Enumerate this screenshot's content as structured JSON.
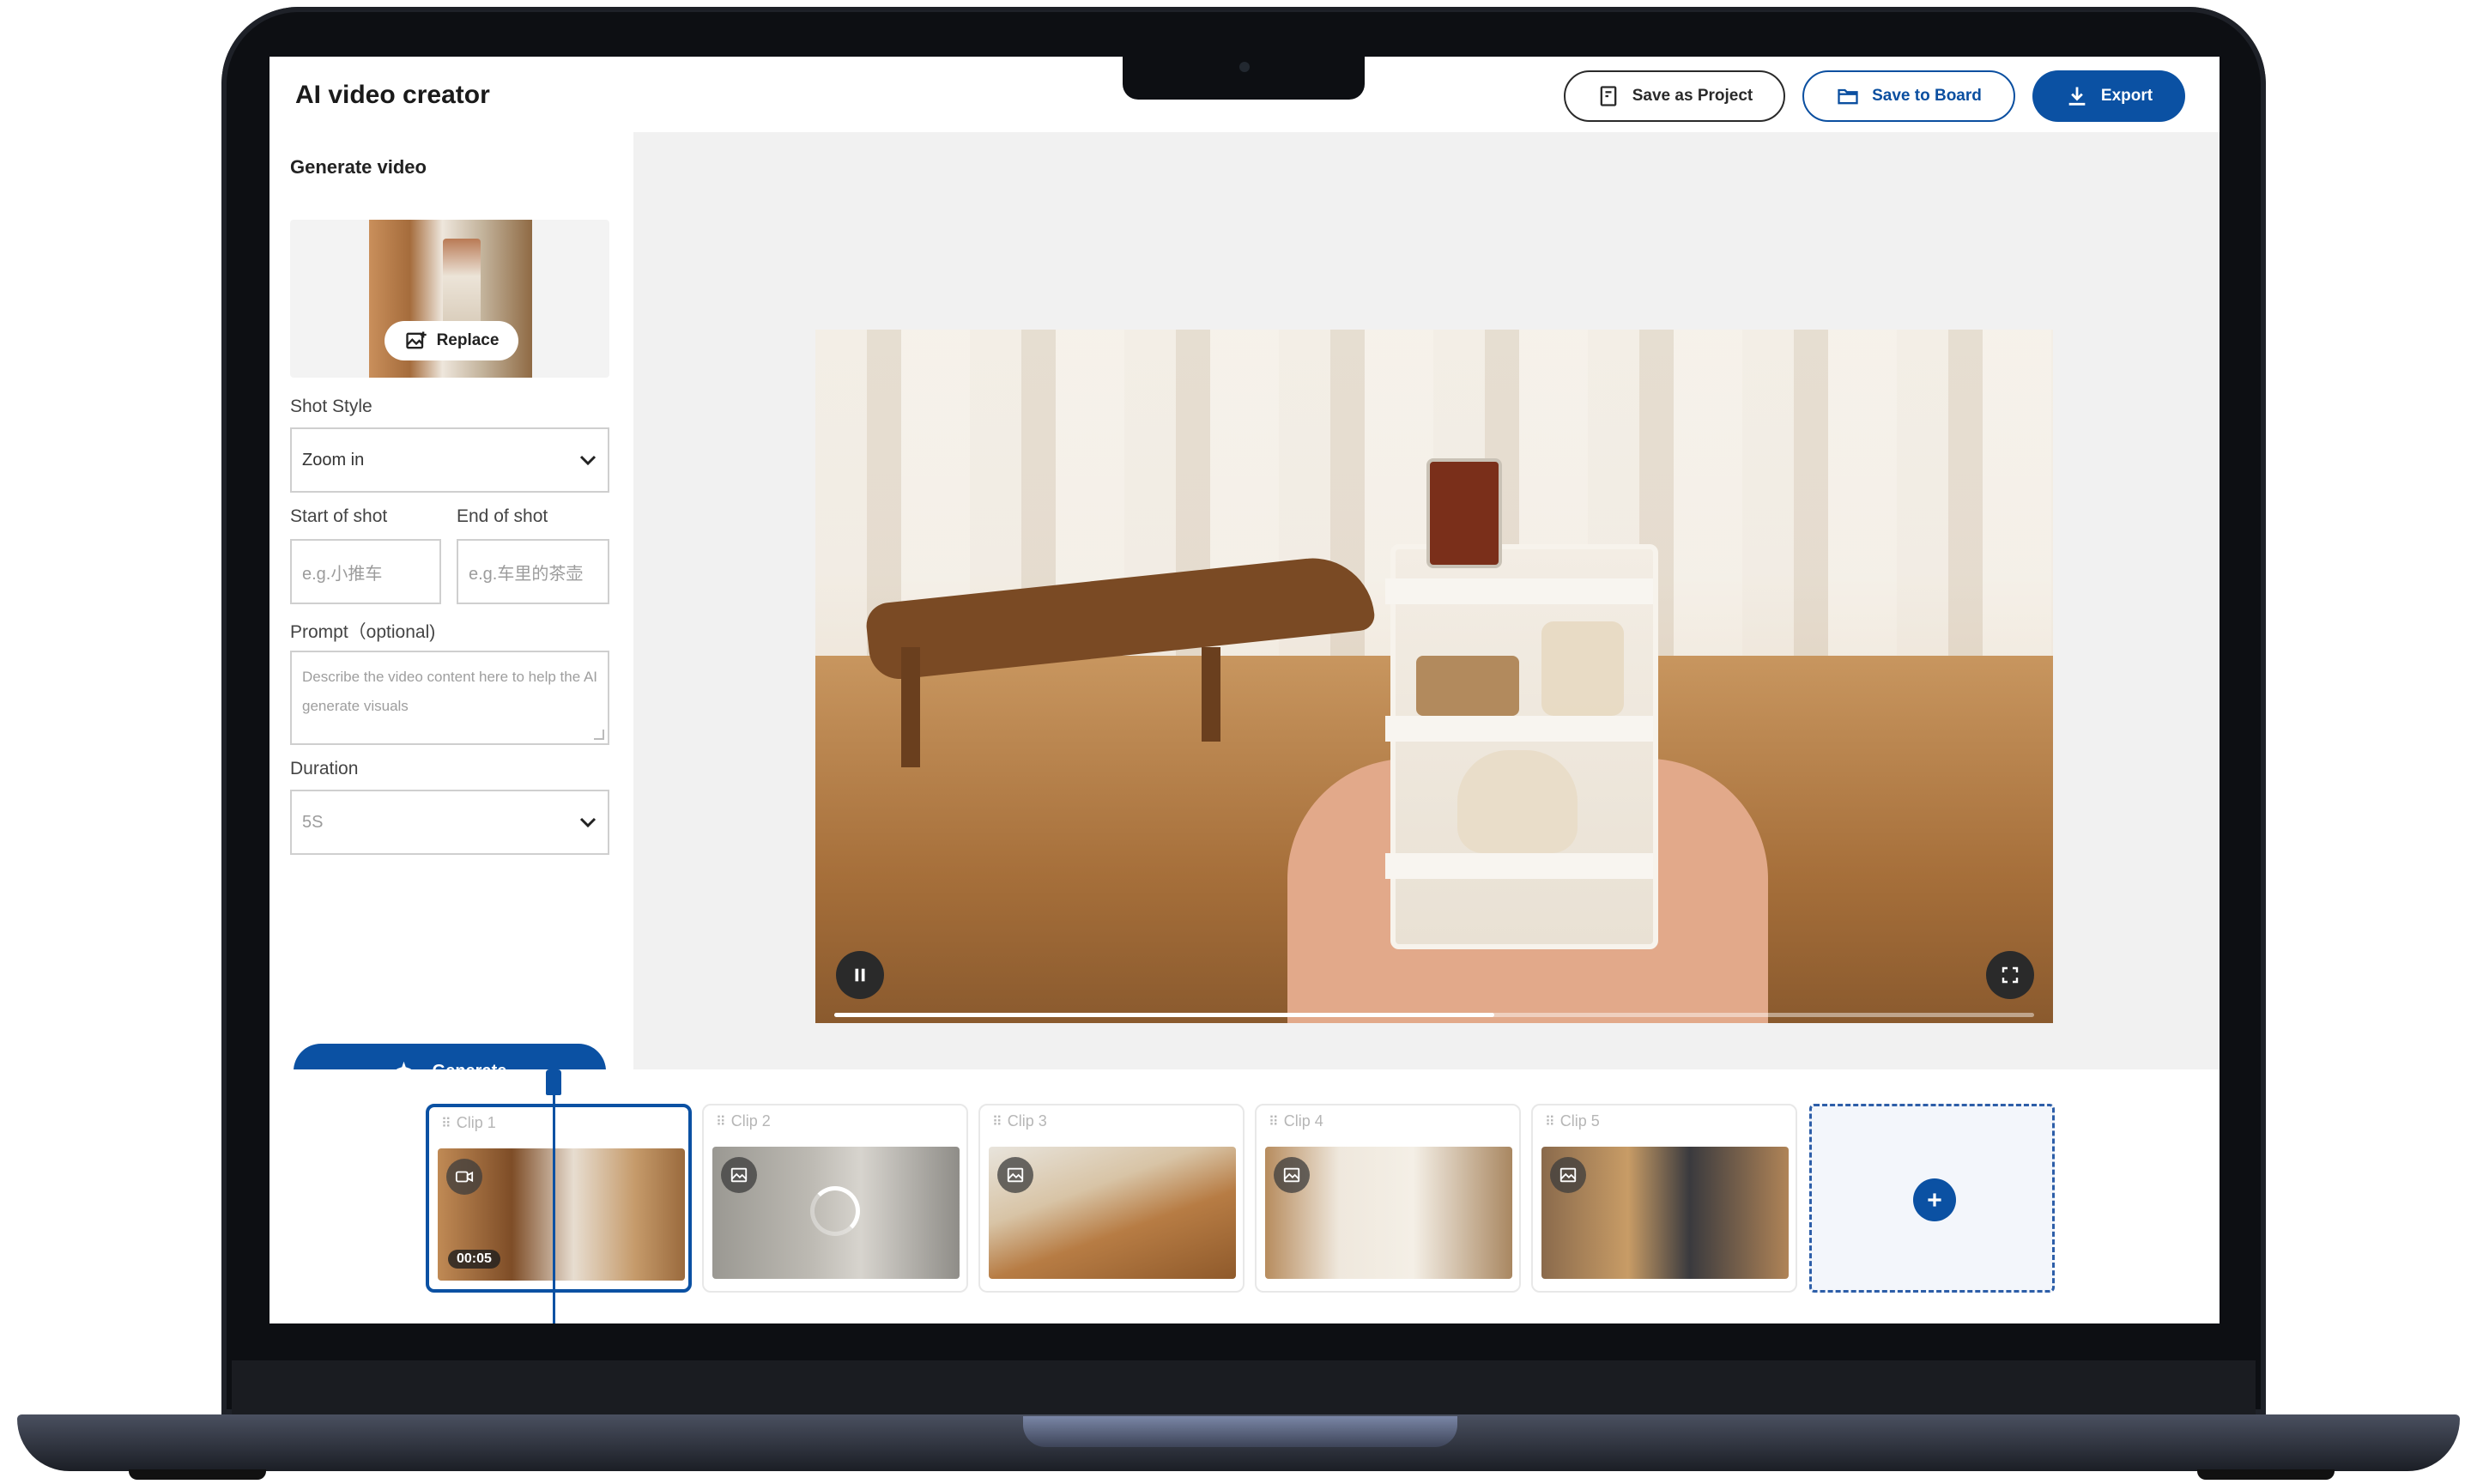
{
  "app": {
    "title": "AI video creator"
  },
  "header": {
    "save_project_label": "Save as Project",
    "save_board_label": "Save to Board",
    "export_label": "Export"
  },
  "generate_panel": {
    "section_title": "Generate video",
    "replace_label": "Replace",
    "shot_style": {
      "label": "Shot Style",
      "value": "Zoom in"
    },
    "start_of_shot": {
      "label": "Start of shot",
      "placeholder": "e.g.小推车"
    },
    "end_of_shot": {
      "label": "End of shot",
      "placeholder": "e.g.车里的茶壶"
    },
    "prompt": {
      "label": "Prompt（optional)",
      "placeholder": "Describe the video content here to help the AI generate visuals"
    },
    "duration": {
      "label": "Duration",
      "value": "5S"
    },
    "generate_label": "Generate"
  },
  "player": {
    "progress_fraction": 0.55
  },
  "timeline": {
    "clips": [
      {
        "label": "Clip 1",
        "type": "video",
        "time": "00:05",
        "active": true
      },
      {
        "label": "Clip 2",
        "type": "image",
        "loading": true
      },
      {
        "label": "Clip 3",
        "type": "image"
      },
      {
        "label": "Clip 4",
        "type": "image"
      },
      {
        "label": "Clip 5",
        "type": "image"
      }
    ]
  },
  "colors": {
    "accent": "#0b51a3",
    "accent_outline": "#0b4fa0"
  },
  "icons": {
    "save_project": "document-icon",
    "save_board": "folder-icon",
    "export": "download-icon",
    "replace": "image-replace-icon",
    "generate": "sparkle-icon",
    "pause": "pause-icon",
    "fullscreen": "fullscreen-icon",
    "add": "plus-icon"
  }
}
